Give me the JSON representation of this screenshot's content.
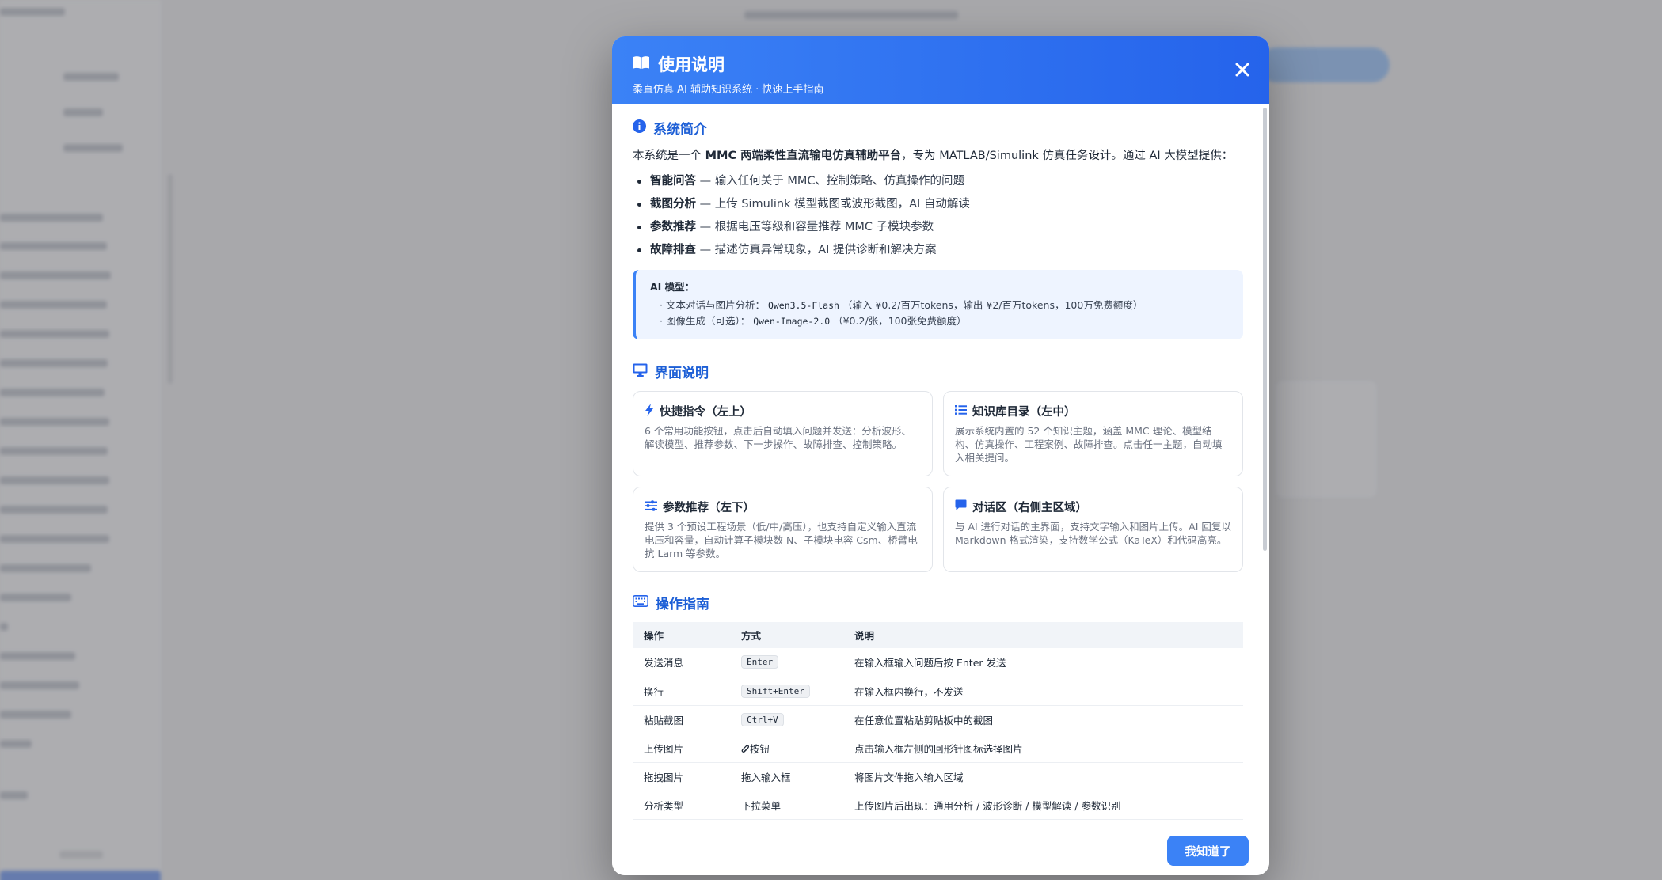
{
  "modal": {
    "title": "使用说明",
    "subtitle": "柔直仿真 AI 辅助知识系统 · 快速上手指南",
    "ok_label": "我知道了"
  },
  "intro": {
    "heading": "系统简介",
    "para_prefix": "本系统是一个 ",
    "para_bold": "MMC 两端柔性直流输电仿真辅助平台",
    "para_suffix": "，专为 MATLAB/Simulink 仿真任务设计。通过 AI 大模型提供：",
    "features": [
      {
        "name": "智能问答",
        "desc": " — 输入任何关于 MMC、控制策略、仿真操作的问题"
      },
      {
        "name": "截图分析",
        "desc": " — 上传 Simulink 模型截图或波形截图，AI 自动解读"
      },
      {
        "name": "参数推荐",
        "desc": " — 根据电压等级和容量推荐 MMC 子模块参数"
      },
      {
        "name": "故障排查",
        "desc": " — 描述仿真异常现象，AI 提供诊断和解决方案"
      }
    ],
    "models": {
      "title": "AI 模型：",
      "line1_prefix": "· 文本对话与图片分析：",
      "line1_code": "Qwen3.5-Flash",
      "line1_suffix": "（输入 ¥0.2/百万tokens，输出 ¥2/百万tokens，100万免费额度）",
      "line2_prefix": "· 图像生成（可选）：",
      "line2_code": "Qwen-Image-2.0",
      "line2_suffix": "（¥0.2/张，100张免费额度）"
    }
  },
  "ui_section": {
    "heading": "界面说明",
    "cards": [
      {
        "title": "快捷指令（左上）",
        "desc": "6 个常用功能按钮，点击后自动填入问题并发送：分析波形、解读模型、推荐参数、下一步操作、故障排查、控制策略。"
      },
      {
        "title": "知识库目录（左中）",
        "desc": "展示系统内置的 52 个知识主题，涵盖 MMC 理论、模型结构、仿真操作、工程案例、故障排查。点击任一主题，自动填入相关提问。"
      },
      {
        "title": "参数推荐（左下）",
        "desc": "提供 3 个预设工程场景（低/中/高压），也支持自定义输入直流电压和容量，自动计算子模块数 N、子模块电容 Csm、桥臂电抗 Larm 等参数。"
      },
      {
        "title": "对话区（右侧主区域）",
        "desc": "与 AI 进行对话的主界面，支持文字输入和图片上传。AI 回复以 Markdown 格式渲染，支持数学公式（KaTeX）和代码高亮。"
      }
    ]
  },
  "ops": {
    "heading": "操作指南",
    "headers": [
      "操作",
      "方式",
      "说明"
    ],
    "rows": [
      {
        "op": "发送消息",
        "method": "Enter",
        "kbd": true,
        "desc": "在输入框输入问题后按 Enter 发送"
      },
      {
        "op": "换行",
        "method": "Shift+Enter",
        "kbd": true,
        "desc": "在输入框内换行，不发送"
      },
      {
        "op": "粘贴截图",
        "method": "Ctrl+V",
        "kbd": true,
        "desc": "在任意位置粘贴剪贴板中的截图"
      },
      {
        "op": "上传图片",
        "method": "按钮",
        "kbd": false,
        "icon": "paperclip-icon",
        "desc": "点击输入框左侧的回形针图标选择图片"
      },
      {
        "op": "拖拽图片",
        "method": "拖入输入框",
        "kbd": false,
        "desc": "将图片文件拖入输入区域"
      },
      {
        "op": "分析类型",
        "method": "下拉菜单",
        "kbd": false,
        "desc": "上传图片后出现：通用分析 / 波形诊断 / 模型解读 / 参数识别"
      }
    ]
  },
  "colors": {
    "primary": "#3b82f6",
    "primary_dark": "#2563eb",
    "heading": "#1d5fd6"
  }
}
